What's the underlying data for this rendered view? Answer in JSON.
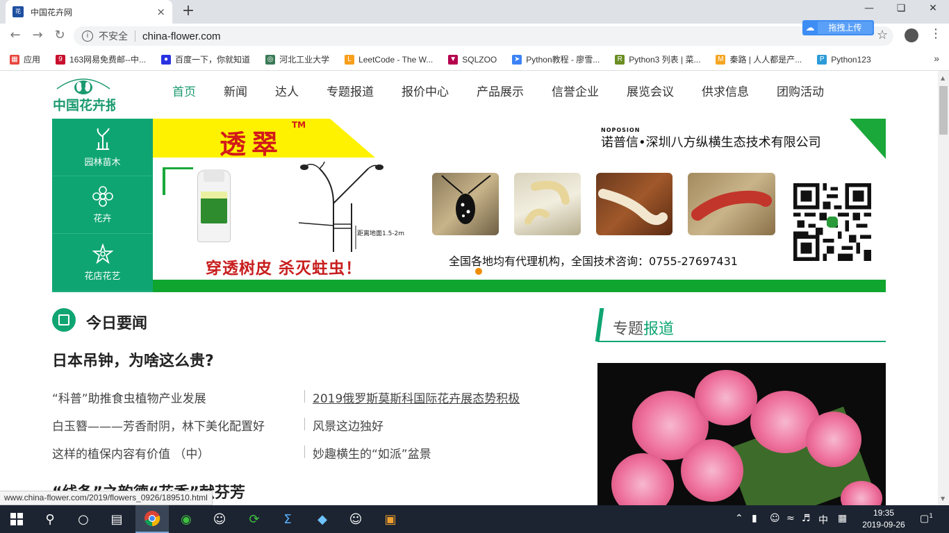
{
  "browser": {
    "tab_title": "中国花卉网",
    "tab_close": "×",
    "new_tab": "+",
    "security_label": "不安全",
    "url": "china-flower.com",
    "upload_label": "拖拽上传",
    "bookmarks": [
      {
        "label": "应用",
        "icon": "apps-grid-icon",
        "color": "#e8453c"
      },
      {
        "label": "163网易免费邮--中...",
        "icon": "mail-163-icon",
        "color": "#c8102e"
      },
      {
        "label": "百度一下，你就知道",
        "icon": "baidu-paw-icon",
        "color": "#2932e1"
      },
      {
        "label": "河北工业大学",
        "icon": "globe-icon",
        "color": "#3b7a57"
      },
      {
        "label": "LeetCode - The W...",
        "icon": "leetcode-icon",
        "color": "#f89f1b"
      },
      {
        "label": "SQLZOO",
        "icon": "sqlzoo-icon",
        "color": "#b5004e"
      },
      {
        "label": "Python教程 - 廖雪...",
        "icon": "rocket-icon",
        "color": "#3b82f6"
      },
      {
        "label": "Python3 列表 | 菜...",
        "icon": "runoob-icon",
        "color": "#6b8e23"
      },
      {
        "label": "秦路 | 人人都是产...",
        "icon": "zhihu-m-icon",
        "color": "#f5a623"
      },
      {
        "label": "Python123",
        "icon": "python123-icon",
        "color": "#2b9bd8"
      }
    ],
    "bookmarks_more": "»",
    "status_url": "www.china-flower.com/2019/flowers_0926/189510.html"
  },
  "site": {
    "nav": [
      "首页",
      "新闻",
      "达人",
      "专题报道",
      "报价中心",
      "产品展示",
      "信誉企业",
      "展览会议",
      "供求信息",
      "团购活动"
    ],
    "categories": [
      {
        "label": "园林苗木",
        "icon": "plant-icon"
      },
      {
        "label": "花卉",
        "icon": "flower-icon"
      },
      {
        "label": "花店花艺",
        "icon": "bouquet-icon"
      }
    ],
    "banner": {
      "title": "透翠",
      "trademark": "TM",
      "brand": "NOPOSION",
      "company": "诺普信•深圳八方纵横生态技术有限公司",
      "dist_label": "距离地面1.5-2m",
      "slogan": "穿透树皮 杀灭蛀虫！",
      "agent": "全国各地均有代理机构，全国技术咨询：0755-27697431"
    },
    "news": {
      "section_title": "今日要闻",
      "headline": "日本吊钟，为啥这么贵?",
      "left_items": [
        "“科普”助推食虫植物产业发展",
        "白玉簪———芳香耐阴，林下美化配置好",
        "这样的植保内容有价值 （中）"
      ],
      "right_items": [
        "2019俄罗斯莫斯科国际花卉展态势积极",
        "风景这边独好",
        "妙趣横生的“如派”盆景"
      ],
      "headline2": "“线条”之韵德“花香”献芬芳"
    },
    "topic": {
      "title_a": "专题",
      "title_b": "报道"
    }
  },
  "taskbar": {
    "ime": "中",
    "time": "19:35",
    "date": "2019-09-26",
    "notification_count": "1"
  },
  "colors": {
    "brand_green": "#0fa573",
    "banner_red": "#d21a1a",
    "banner_yellow": "#fff200"
  }
}
